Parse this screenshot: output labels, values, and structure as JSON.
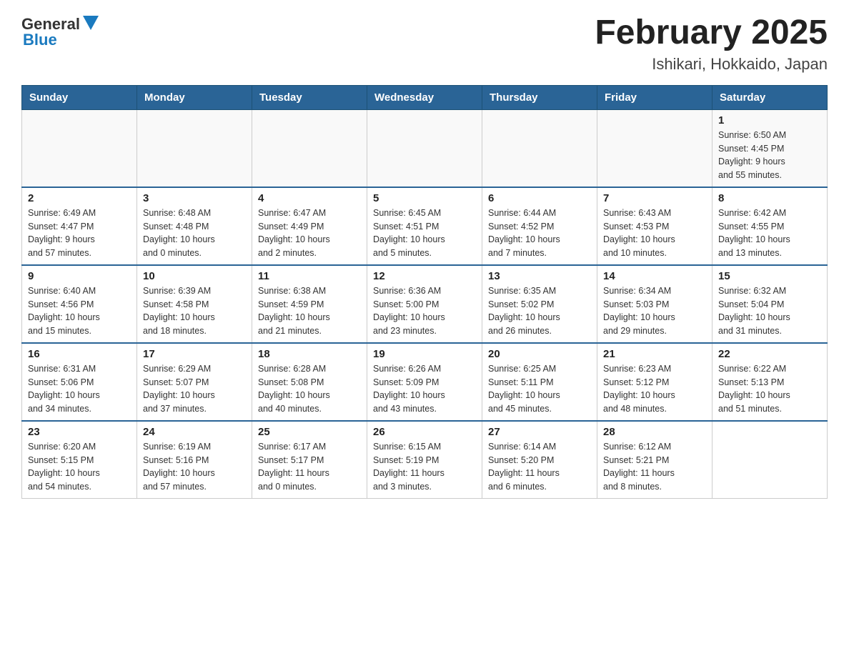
{
  "header": {
    "logo_general": "General",
    "logo_blue": "Blue",
    "title": "February 2025",
    "subtitle": "Ishikari, Hokkaido, Japan"
  },
  "weekdays": [
    "Sunday",
    "Monday",
    "Tuesday",
    "Wednesday",
    "Thursday",
    "Friday",
    "Saturday"
  ],
  "weeks": [
    [
      {
        "day": "",
        "info": ""
      },
      {
        "day": "",
        "info": ""
      },
      {
        "day": "",
        "info": ""
      },
      {
        "day": "",
        "info": ""
      },
      {
        "day": "",
        "info": ""
      },
      {
        "day": "",
        "info": ""
      },
      {
        "day": "1",
        "info": "Sunrise: 6:50 AM\nSunset: 4:45 PM\nDaylight: 9 hours\nand 55 minutes."
      }
    ],
    [
      {
        "day": "2",
        "info": "Sunrise: 6:49 AM\nSunset: 4:47 PM\nDaylight: 9 hours\nand 57 minutes."
      },
      {
        "day": "3",
        "info": "Sunrise: 6:48 AM\nSunset: 4:48 PM\nDaylight: 10 hours\nand 0 minutes."
      },
      {
        "day": "4",
        "info": "Sunrise: 6:47 AM\nSunset: 4:49 PM\nDaylight: 10 hours\nand 2 minutes."
      },
      {
        "day": "5",
        "info": "Sunrise: 6:45 AM\nSunset: 4:51 PM\nDaylight: 10 hours\nand 5 minutes."
      },
      {
        "day": "6",
        "info": "Sunrise: 6:44 AM\nSunset: 4:52 PM\nDaylight: 10 hours\nand 7 minutes."
      },
      {
        "day": "7",
        "info": "Sunrise: 6:43 AM\nSunset: 4:53 PM\nDaylight: 10 hours\nand 10 minutes."
      },
      {
        "day": "8",
        "info": "Sunrise: 6:42 AM\nSunset: 4:55 PM\nDaylight: 10 hours\nand 13 minutes."
      }
    ],
    [
      {
        "day": "9",
        "info": "Sunrise: 6:40 AM\nSunset: 4:56 PM\nDaylight: 10 hours\nand 15 minutes."
      },
      {
        "day": "10",
        "info": "Sunrise: 6:39 AM\nSunset: 4:58 PM\nDaylight: 10 hours\nand 18 minutes."
      },
      {
        "day": "11",
        "info": "Sunrise: 6:38 AM\nSunset: 4:59 PM\nDaylight: 10 hours\nand 21 minutes."
      },
      {
        "day": "12",
        "info": "Sunrise: 6:36 AM\nSunset: 5:00 PM\nDaylight: 10 hours\nand 23 minutes."
      },
      {
        "day": "13",
        "info": "Sunrise: 6:35 AM\nSunset: 5:02 PM\nDaylight: 10 hours\nand 26 minutes."
      },
      {
        "day": "14",
        "info": "Sunrise: 6:34 AM\nSunset: 5:03 PM\nDaylight: 10 hours\nand 29 minutes."
      },
      {
        "day": "15",
        "info": "Sunrise: 6:32 AM\nSunset: 5:04 PM\nDaylight: 10 hours\nand 31 minutes."
      }
    ],
    [
      {
        "day": "16",
        "info": "Sunrise: 6:31 AM\nSunset: 5:06 PM\nDaylight: 10 hours\nand 34 minutes."
      },
      {
        "day": "17",
        "info": "Sunrise: 6:29 AM\nSunset: 5:07 PM\nDaylight: 10 hours\nand 37 minutes."
      },
      {
        "day": "18",
        "info": "Sunrise: 6:28 AM\nSunset: 5:08 PM\nDaylight: 10 hours\nand 40 minutes."
      },
      {
        "day": "19",
        "info": "Sunrise: 6:26 AM\nSunset: 5:09 PM\nDaylight: 10 hours\nand 43 minutes."
      },
      {
        "day": "20",
        "info": "Sunrise: 6:25 AM\nSunset: 5:11 PM\nDaylight: 10 hours\nand 45 minutes."
      },
      {
        "day": "21",
        "info": "Sunrise: 6:23 AM\nSunset: 5:12 PM\nDaylight: 10 hours\nand 48 minutes."
      },
      {
        "day": "22",
        "info": "Sunrise: 6:22 AM\nSunset: 5:13 PM\nDaylight: 10 hours\nand 51 minutes."
      }
    ],
    [
      {
        "day": "23",
        "info": "Sunrise: 6:20 AM\nSunset: 5:15 PM\nDaylight: 10 hours\nand 54 minutes."
      },
      {
        "day": "24",
        "info": "Sunrise: 6:19 AM\nSunset: 5:16 PM\nDaylight: 10 hours\nand 57 minutes."
      },
      {
        "day": "25",
        "info": "Sunrise: 6:17 AM\nSunset: 5:17 PM\nDaylight: 11 hours\nand 0 minutes."
      },
      {
        "day": "26",
        "info": "Sunrise: 6:15 AM\nSunset: 5:19 PM\nDaylight: 11 hours\nand 3 minutes."
      },
      {
        "day": "27",
        "info": "Sunrise: 6:14 AM\nSunset: 5:20 PM\nDaylight: 11 hours\nand 6 minutes."
      },
      {
        "day": "28",
        "info": "Sunrise: 6:12 AM\nSunset: 5:21 PM\nDaylight: 11 hours\nand 8 minutes."
      },
      {
        "day": "",
        "info": ""
      }
    ]
  ]
}
